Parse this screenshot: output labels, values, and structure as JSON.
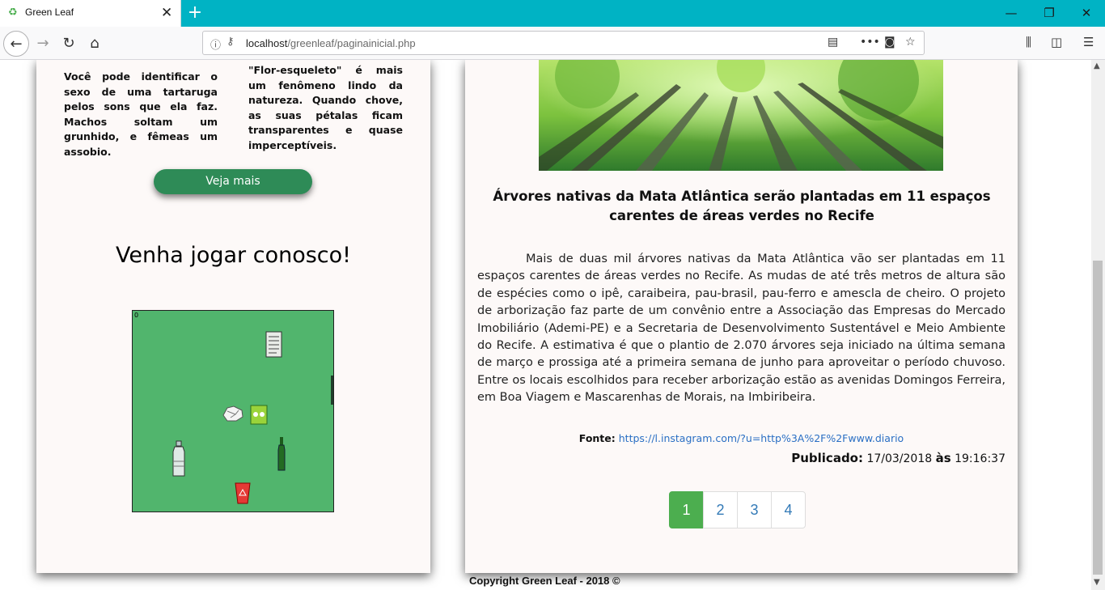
{
  "browser": {
    "tab_title": "Green Leaf",
    "new_tab": "+",
    "url_host": "localhost",
    "url_path": "/greenleaf/paginainicial.php",
    "window_controls": [
      "—",
      "❐",
      "✕"
    ]
  },
  "left": {
    "fact1": "Você pode identificar o sexo de uma tartaruga pelos sons que ela faz. Machos soltam um grunhido, e fêmeas um assobio.",
    "fact2": "\"Flor-esqueleto\" é mais um fenômeno lindo da natureza. Quando chove, as suas pétalas ficam transparentes e quase imperceptíveis.",
    "more_button": "Veja mais",
    "game_title": "Venha jogar conosco!",
    "game_score": "0"
  },
  "news": {
    "title": "Árvores nativas da Mata Atlântica serão plantadas em 11 espaços carentes de áreas verdes no Recife",
    "body": "Mais de duas mil árvores nativas da Mata Atlântica vão ser plantadas em 11 espaços carentes de áreas verdes no Recife. As mudas de até três metros de altura são de espécies como o ipê, caraibeira, pau-brasil, pau-ferro e amescla de cheiro. O projeto de arborização faz parte de um convênio entre a Associação das Empresas do Mercado Imobiliário (Ademi-PE) e a Secretaria de Desenvolvimento Sustentável e Meio Ambiente do Recife. A estimativa é que o plantio de 2.070 árvores seja iniciado na última semana de março e prossiga até a primeira semana de junho para aproveitar o período chuvoso. Entre os locais escolhidos para receber arborização estão as avenidas Domingos Ferreira, em Boa Viagem e Mascarenhas de Morais, na Imbiribeira.",
    "fonte_label": "Fonte:",
    "fonte_link": "https://l.instagram.com/?u=http%3A%2F%2Fwww.diario",
    "publicado_label": "Publicado:",
    "publicado_date": "17/03/2018",
    "as_label": "às",
    "publicado_time": "19:16:37"
  },
  "pagination": [
    "1",
    "2",
    "3",
    "4"
  ],
  "footer": {
    "copyright": "Copyright Green Leaf - 2018 ©"
  },
  "colors": {
    "tabbar": "#00b3c4",
    "accent_green": "#2e8b57",
    "active_page": "#4cae4f",
    "game_bg": "#51b56d",
    "link": "#2a6fc4"
  }
}
